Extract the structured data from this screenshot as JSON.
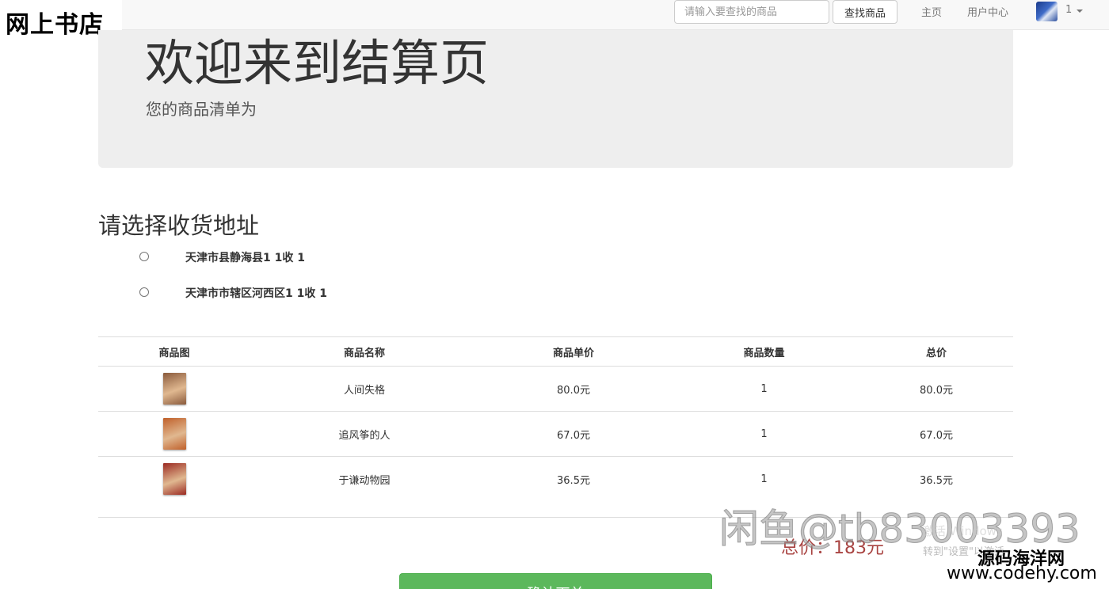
{
  "navbar": {
    "brand": "网上书店",
    "search_placeholder": "请输入要查找的商品",
    "search_button": "查找商品",
    "links": {
      "home": "主页",
      "user_center": "用户中心"
    },
    "user_count": "1"
  },
  "jumbotron": {
    "title": "欢迎来到结算页",
    "subtitle": "您的商品清单为"
  },
  "address": {
    "heading": "请选择收货地址",
    "options": [
      {
        "text": "天津市县静海县1 1收 1"
      },
      {
        "text": "天津市市辖区河西区1 1收 1"
      }
    ]
  },
  "table": {
    "headers": [
      "商品图",
      "商品名称",
      "商品单价",
      "商品数量",
      "总价"
    ],
    "rows": [
      {
        "name": "人间失格",
        "price": "80.0元",
        "quantity": "1",
        "total": "80.0元",
        "cover_color": "#8a5a3c"
      },
      {
        "name": "追风筝的人",
        "price": "67.0元",
        "quantity": "1",
        "total": "67.0元",
        "cover_color": "#c0602a"
      },
      {
        "name": "于谦动物园",
        "price": "36.5元",
        "quantity": "1",
        "total": "36.5元",
        "cover_color": "#9b2a22"
      }
    ]
  },
  "total": {
    "label": "总价：183元"
  },
  "confirm_button": "确认下单",
  "watermarks": {
    "main": "闲鱼@tb83003393",
    "activate_line1": "激活 Windows",
    "activate_line2": "转到\"设置\"以激活",
    "site_name": "源码海洋网",
    "site_url": "www.codehy.com"
  },
  "colors": {
    "primary_green": "#5cb85c",
    "total_red": "#a94442",
    "jumbotron_bg": "#eeeeee"
  }
}
